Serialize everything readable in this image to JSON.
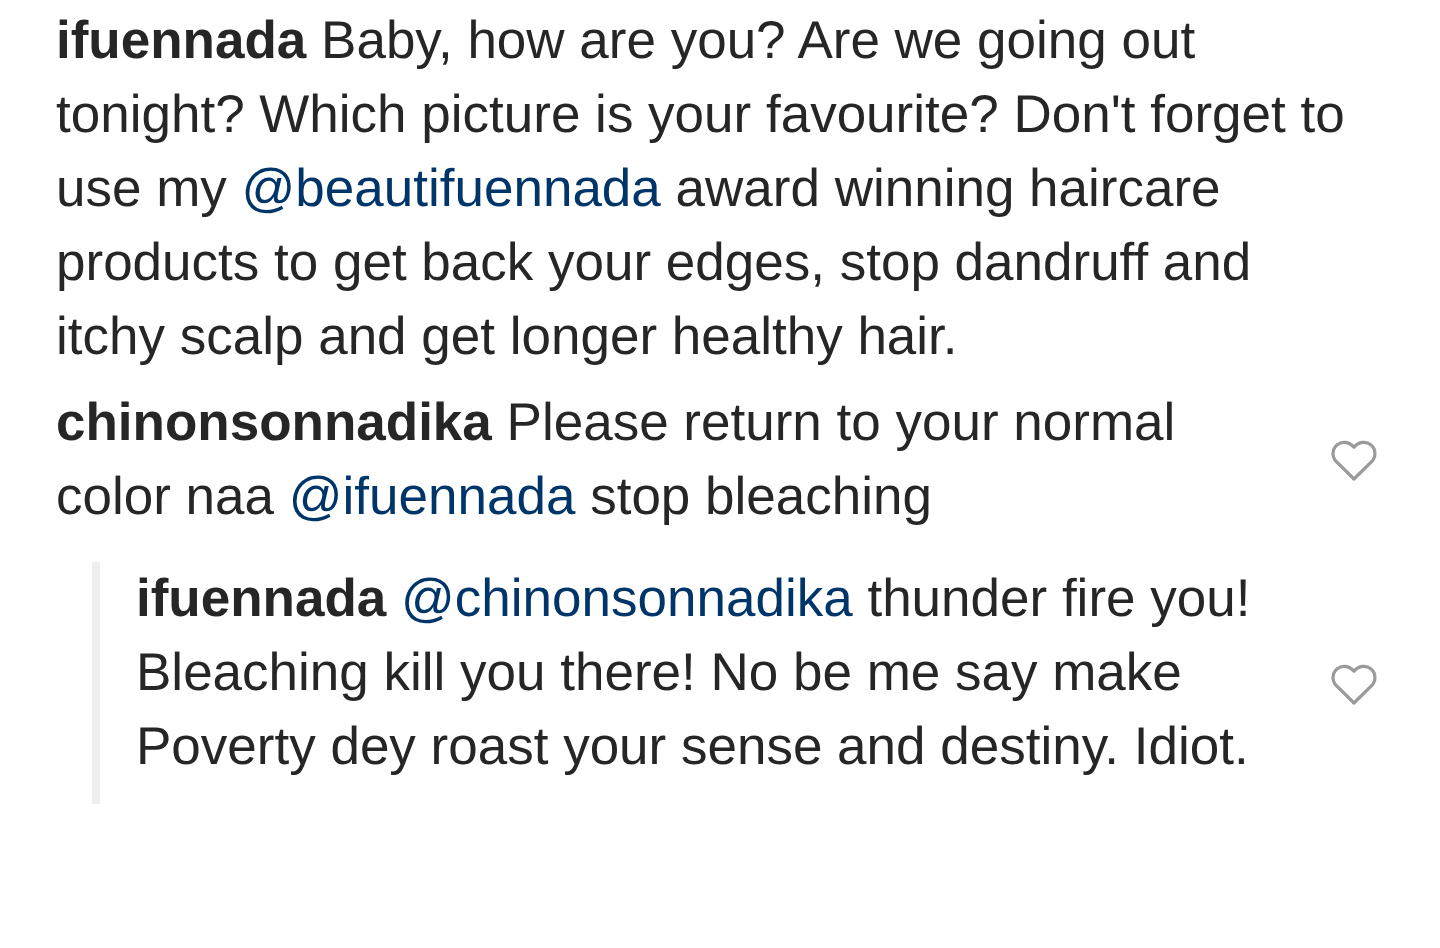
{
  "comments": [
    {
      "username": "ifuennada",
      "has_like": false,
      "reply": false,
      "parts": [
        {
          "kind": "text",
          "text": "Baby, how are you? Are we going out tonight? Which picture is your favourite? Don't forget to use my "
        },
        {
          "kind": "mention",
          "text": "@beautifuennada"
        },
        {
          "kind": "text",
          "text": " award winning haircare products to get back your edges, stop dandruff and itchy scalp and get longer healthy hair."
        }
      ]
    },
    {
      "username": "chinonsonnadika",
      "has_like": true,
      "liked": false,
      "reply": false,
      "parts": [
        {
          "kind": "text",
          "text": "Please return to your normal color naa "
        },
        {
          "kind": "mention",
          "text": "@ifuennada"
        },
        {
          "kind": "text",
          "text": " stop bleaching"
        }
      ]
    },
    {
      "username": "ifuennada",
      "has_like": true,
      "liked": false,
      "reply": true,
      "parts": [
        {
          "kind": "mention",
          "text": "@chinonsonnadika"
        },
        {
          "kind": "text",
          "text": " thunder fire you! Bleaching kill you there! No be me say make Poverty dey roast your sense and destiny. Idiot."
        }
      ]
    }
  ]
}
